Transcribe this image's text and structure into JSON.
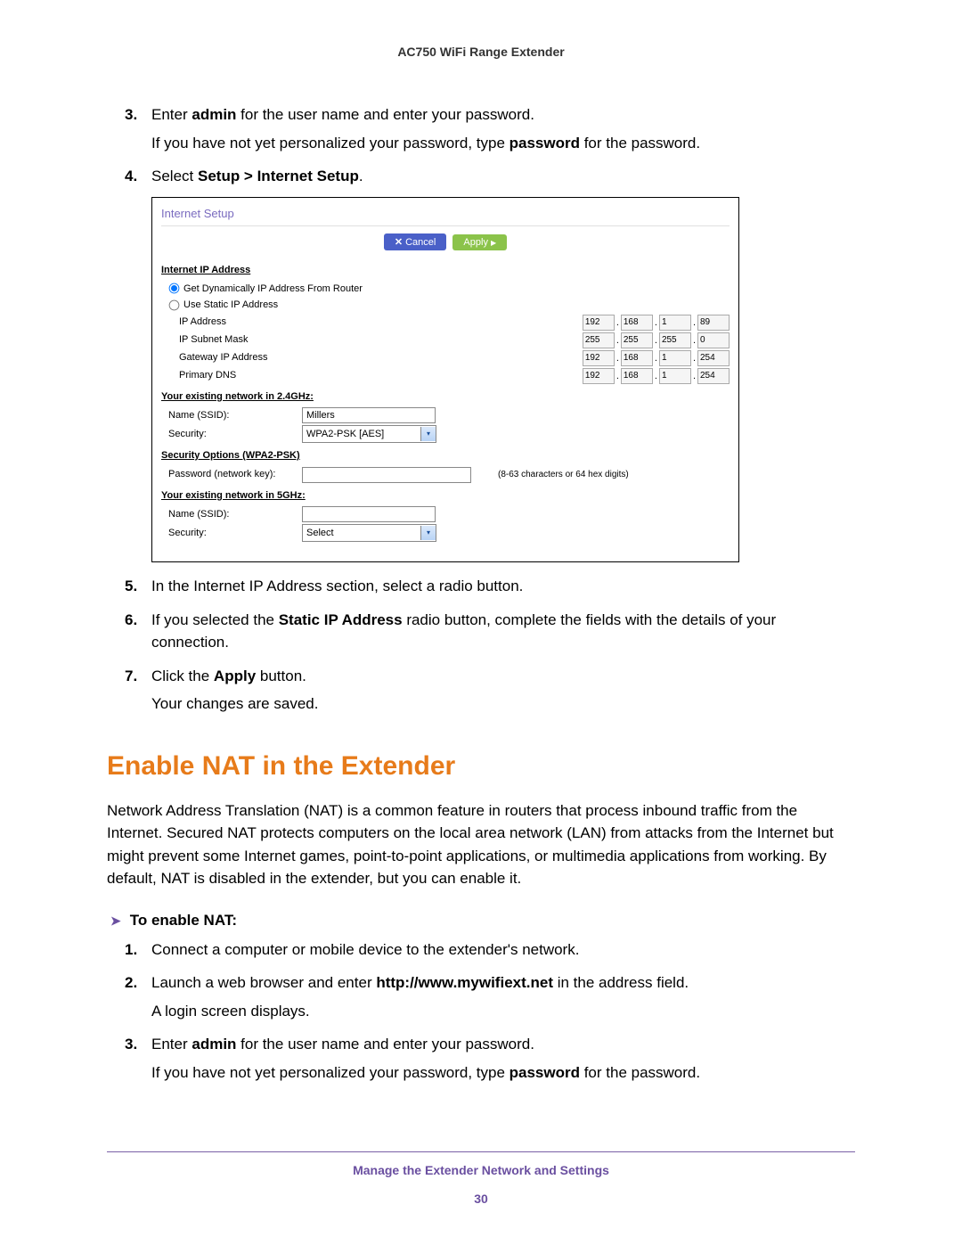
{
  "header": {
    "title": "AC750 WiFi Range Extender"
  },
  "steps_top": {
    "s3_num": "3.",
    "s3_a": "Enter ",
    "s3_b_bold": "admin",
    "s3_c": " for the user name and enter your password.",
    "s3_note_a": "If you have not yet personalized your password, type ",
    "s3_note_b_bold": "password",
    "s3_note_c": " for the password.",
    "s4_num": "4.",
    "s4_a": "Select ",
    "s4_b_bold": "Setup > Internet Setup",
    "s4_c": ".",
    "s5_num": "5.",
    "s5_text": "In the Internet IP Address section, select a radio button.",
    "s6_num": "6.",
    "s6_a": "If you selected the ",
    "s6_b_bold": "Static IP Address",
    "s6_c": " radio button, complete the fields with the details of your connection.",
    "s7_num": "7.",
    "s7_a": "Click the ",
    "s7_b_bold": "Apply",
    "s7_c": " button.",
    "s7_note": "Your changes are saved."
  },
  "shot": {
    "title": "Internet Setup",
    "btn_cancel": "Cancel",
    "btn_apply": "Apply",
    "sec_ip": "Internet IP Address",
    "radio_dyn": "Get Dynamically IP Address From Router",
    "radio_static": "Use Static IP Address",
    "lbl_ip": "IP Address",
    "lbl_mask": "IP Subnet Mask",
    "lbl_gw": "Gateway IP Address",
    "lbl_dns": "Primary DNS",
    "ip": [
      "192",
      "168",
      "1",
      "89"
    ],
    "mask": [
      "255",
      "255",
      "255",
      "0"
    ],
    "gw": [
      "192",
      "168",
      "1",
      "254"
    ],
    "dns": [
      "192",
      "168",
      "1",
      "254"
    ],
    "sec_24": "Your existing network in 2.4GHz:",
    "lbl_ssid": "Name (SSID):",
    "ssid24": "Millers",
    "lbl_sec": "Security:",
    "sec24_sel": "WPA2-PSK [AES]",
    "sec_opts": "Security Options (WPA2-PSK)",
    "lbl_pwd": "Password (network key):",
    "pwd_hint": "(8-63 characters or 64 hex digits)",
    "sec_5": "Your existing network in 5GHz:",
    "ssid5": "",
    "sec5_sel": "Select"
  },
  "section": {
    "heading": "Enable NAT in the Extender",
    "para": "Network Address Translation (NAT) is a common feature in routers that process inbound traffic from the Internet. Secured NAT protects computers on the local area network (LAN) from attacks from the Internet but might prevent some Internet games, point-to-point applications, or multimedia applications from working. By default, NAT is disabled in the extender, but you can enable it.",
    "proc_lead": "To enable NAT:"
  },
  "steps_bottom": {
    "s1_num": "1.",
    "s1_text": "Connect a computer or mobile device to the extender's network.",
    "s2_num": "2.",
    "s2_a": "Launch a web browser and enter ",
    "s2_b_bold": "http://www.mywifiext.net",
    "s2_c": " in the address field.",
    "s2_note": "A login screen displays.",
    "s3_num": "3.",
    "s3_a": "Enter ",
    "s3_b_bold": "admin",
    "s3_c": " for the user name and enter your password.",
    "s3_note_a": "If you have not yet personalized your password, type ",
    "s3_note_b_bold": "password",
    "s3_note_c": " for the password."
  },
  "footer": {
    "text": "Manage the Extender Network and Settings",
    "page": "30"
  }
}
